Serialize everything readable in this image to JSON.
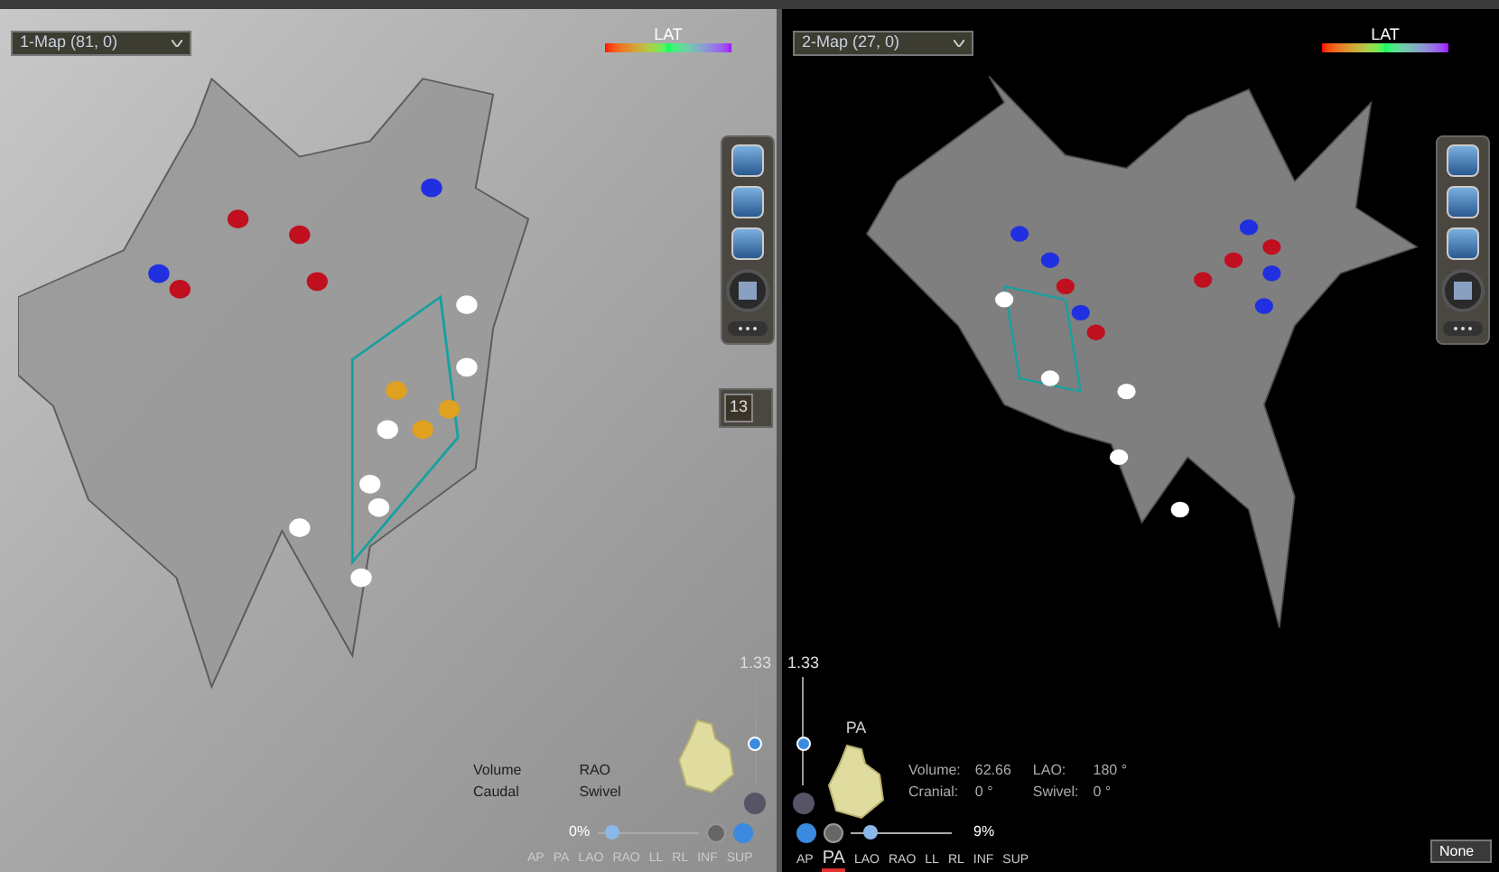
{
  "panes": [
    {
      "kind": "fluoro",
      "map_select": {
        "value": "1-Map (81, 0)"
      },
      "legend": {
        "label": "LAT"
      },
      "zoom": {
        "reading": "1.33",
        "level": 0.35
      },
      "info": [
        {
          "label": "Volume"
        },
        {
          "label": "RAO"
        },
        {
          "label": "Caudal"
        },
        {
          "label": "Swivel"
        }
      ],
      "opacity": {
        "reading": "0%",
        "level": 0.1
      },
      "views": [
        {
          "label": "AP",
          "selected": false
        },
        {
          "label": "PA",
          "selected": false
        },
        {
          "label": "LAO",
          "selected": false
        },
        {
          "label": "RAO",
          "selected": false
        },
        {
          "label": "LL",
          "selected": false
        },
        {
          "label": "RL",
          "selected": false
        },
        {
          "label": "INF",
          "selected": false
        },
        {
          "label": "SUP",
          "selected": false
        }
      ],
      "counter": "13"
    },
    {
      "kind": "dark",
      "map_select": {
        "value": "2-Map (27, 0)"
      },
      "legend": {
        "label": "LAT"
      },
      "zoom": {
        "reading": "1.33",
        "level": 0.35
      },
      "info": [
        {
          "label": "Volume:",
          "value": "62.66"
        },
        {
          "label": "LAO:",
          "value": "180 °"
        },
        {
          "label": "Cranial:",
          "value": "0 °"
        },
        {
          "label": "Swivel:",
          "value": "0 °"
        }
      ],
      "opacity": {
        "reading": "9%",
        "level": 0.15
      },
      "heart_label": "PA",
      "views": [
        {
          "label": "AP",
          "selected": false
        },
        {
          "label": "PA",
          "selected": true
        },
        {
          "label": "LAO",
          "selected": false
        },
        {
          "label": "RAO",
          "selected": false
        },
        {
          "label": "LL",
          "selected": false
        },
        {
          "label": "RL",
          "selected": false
        },
        {
          "label": "INF",
          "selected": false
        },
        {
          "label": "SUP",
          "selected": false
        }
      ]
    }
  ],
  "layer_select": {
    "value": "None"
  }
}
